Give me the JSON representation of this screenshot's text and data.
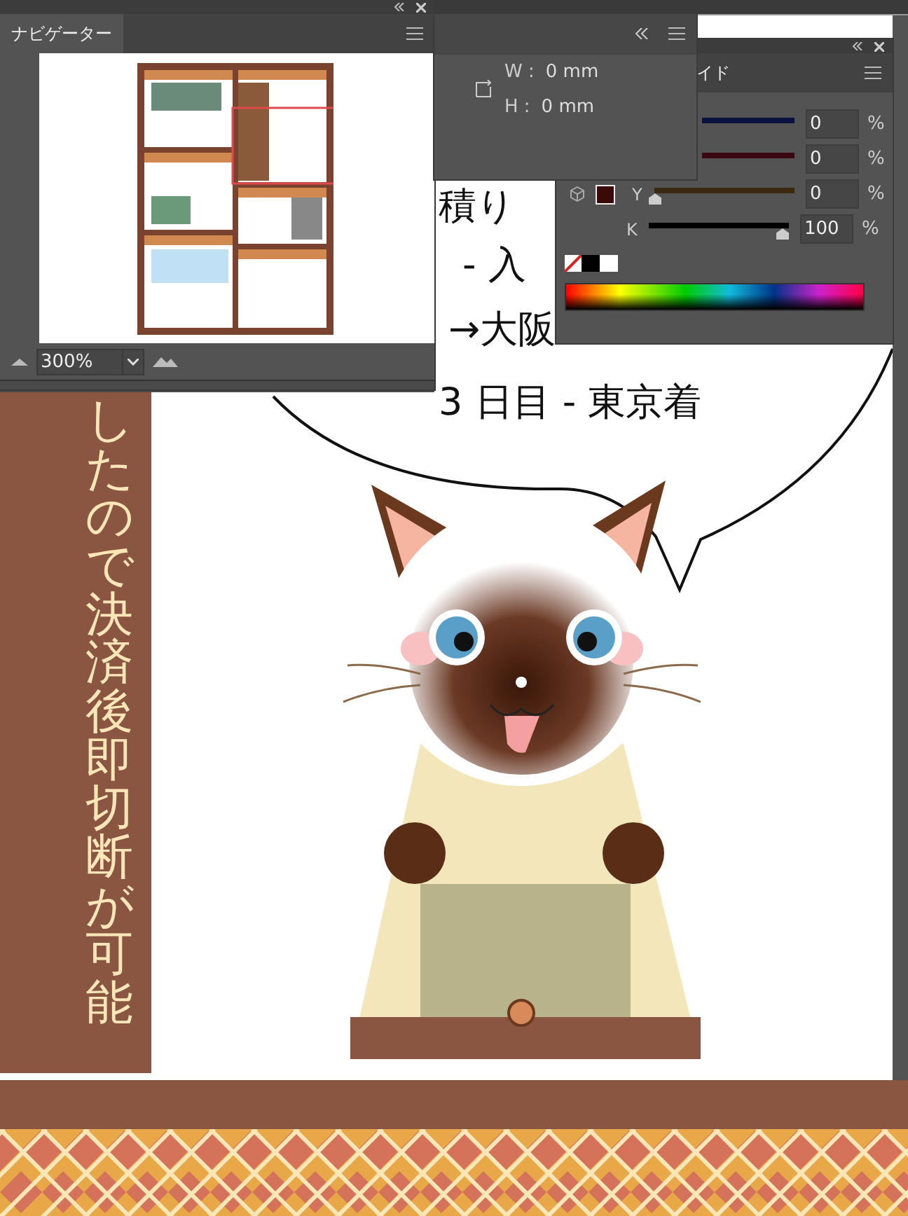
{
  "navigator": {
    "title": "ナビゲーター",
    "zoom": "300%"
  },
  "transform": {
    "fields": [
      {
        "label": "W :",
        "value": "0 mm"
      },
      {
        "label": "H :",
        "value": "0 mm"
      }
    ]
  },
  "color_panel": {
    "tab": "イド",
    "channels": [
      {
        "value": "0",
        "unit": "%",
        "color": "#0a1240"
      },
      {
        "value": "0",
        "unit": "%",
        "color": "#3a0810"
      },
      {
        "label": "Y",
        "value": "0",
        "unit": "%",
        "level": 0,
        "color": "#3a2a10"
      },
      {
        "label": "K",
        "value": "100",
        "unit": "%",
        "level": 1,
        "color": "#000000"
      }
    ],
    "swatch": {
      "color": "#3a0a08"
    }
  },
  "document": {
    "bubble_lines": [
      "積り",
      "- 入",
      "→大阪",
      "3 日目 - 東京着"
    ],
    "vertical_text": "したので決済後即切断が可能"
  }
}
